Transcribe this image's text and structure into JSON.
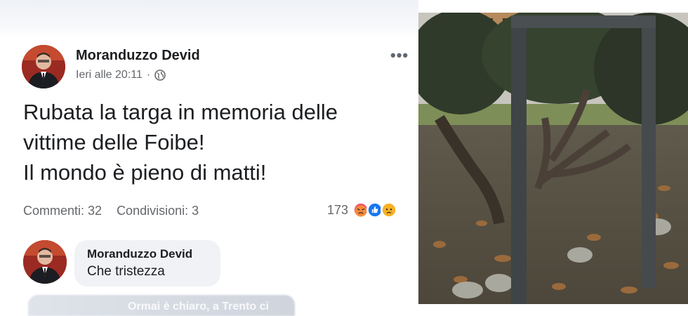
{
  "post": {
    "author": "Moranduzzo Devid",
    "timestamp": "Ieri alle 20:11",
    "separator": "·",
    "privacy_icon": "globe-icon",
    "more_label": "•••",
    "body_lines": [
      "Rubata la targa in memoria delle",
      "vittime delle Foibe!",
      "Il mondo è pieno di matti!"
    ],
    "comments_label": "Commenti: 32",
    "shares_label": "Condivisioni: 3",
    "reaction_count": "173",
    "reaction_icons": [
      "angry-reaction-icon",
      "like-reaction-icon",
      "sad-reaction-icon"
    ]
  },
  "comment": {
    "author": "Moranduzzo Devid",
    "text": "Che tristezza"
  },
  "next_comment_preview": "Ormai è chiaro, a Trento ci",
  "colors": {
    "text": "#1c1e21",
    "meta": "#65676b",
    "bubble": "#f0f2f5",
    "like_blue": "#1877f2",
    "angry": "#f25268",
    "sad": "#f7b125"
  }
}
